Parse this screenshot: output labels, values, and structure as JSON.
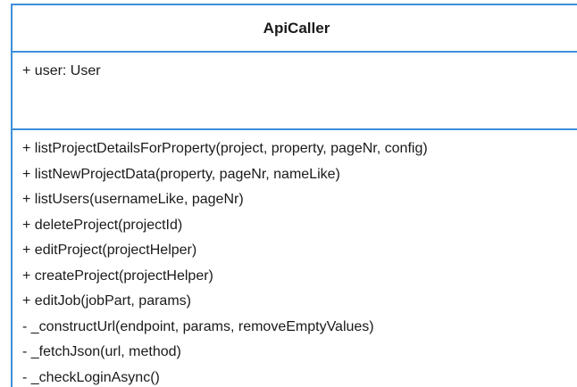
{
  "class": {
    "name": "ApiCaller",
    "attributes": [
      "+ user: User"
    ],
    "methods": [
      "+ listProjectDetailsForProperty(project, property, pageNr, config)",
      "+ listNewProjectData(property, pageNr, nameLike)",
      "+ listUsers(usernameLike, pageNr)",
      "+ deleteProject(projectId)",
      "+ editProject(projectHelper)",
      "+ createProject(projectHelper)",
      "+ editJob(jobPart, params)",
      "- _constructUrl(endpoint, params, removeEmptyValues)",
      "- _fetchJson(url, method)",
      "- _checkLoginAsync()"
    ]
  },
  "colors": {
    "border": "#3d8fd9",
    "text": "#1a1a1a",
    "background": "#ffffff"
  }
}
